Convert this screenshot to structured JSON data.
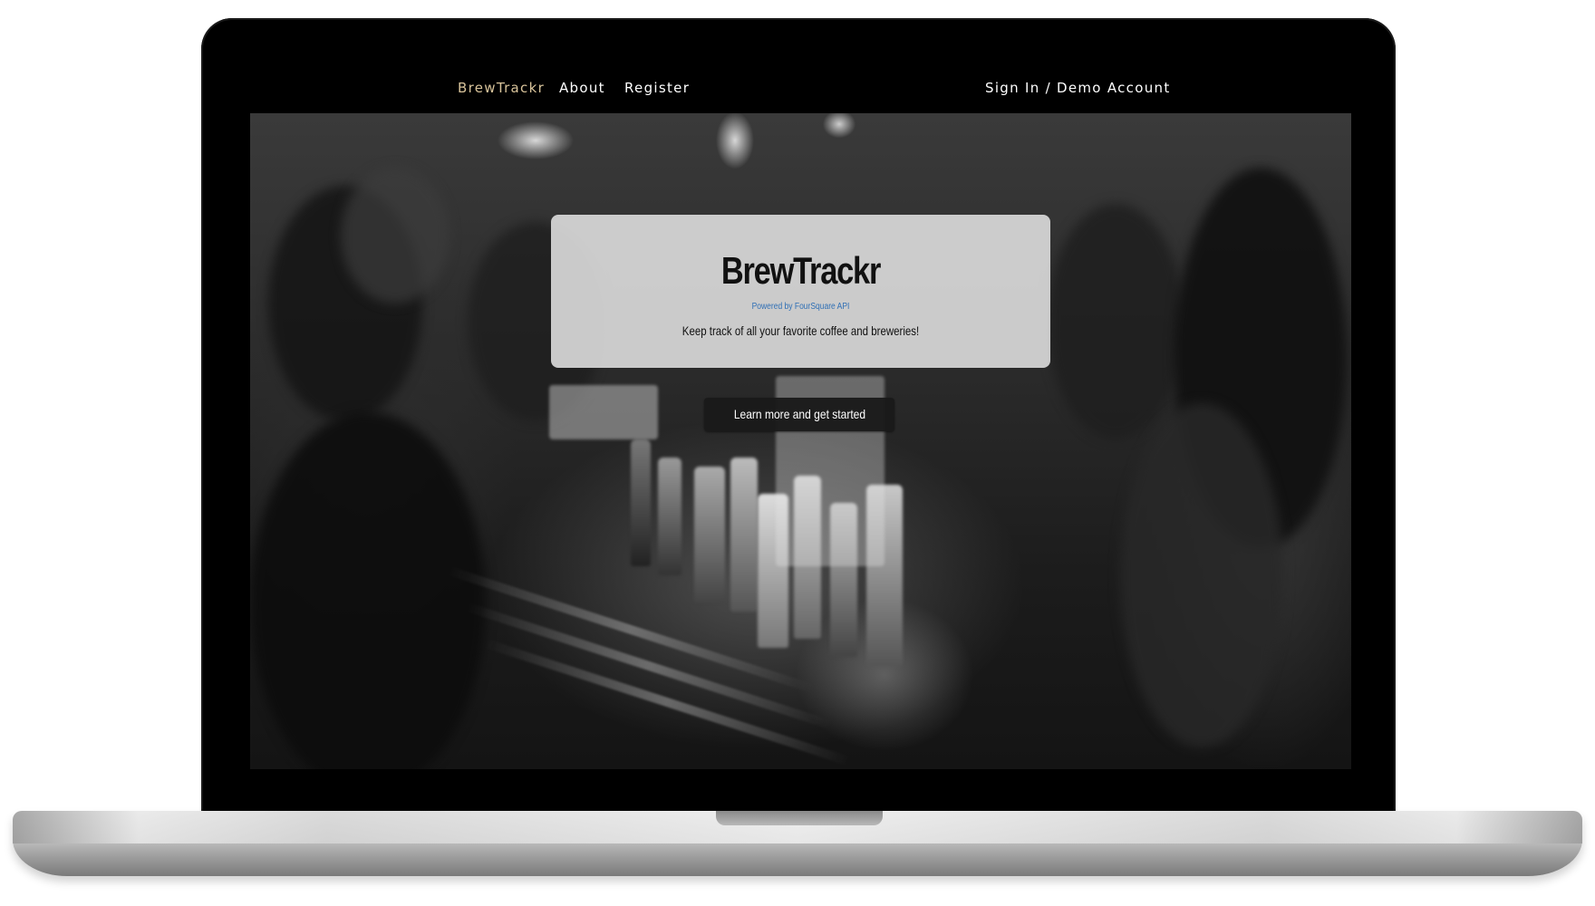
{
  "nav": {
    "brand": "BrewTrackr",
    "about": "About",
    "register": "Register",
    "signin": "Sign In / Demo Account"
  },
  "hero": {
    "title": "BrewTrackr",
    "powered_by": "Powered by FourSquare API",
    "tagline": "Keep track of all your favorite coffee and breweries!",
    "cta_label": "Learn more and get started"
  },
  "colors": {
    "brand_accent": "#d8c39a",
    "link_blue": "#2f6fb5",
    "bezel": "#000000"
  }
}
